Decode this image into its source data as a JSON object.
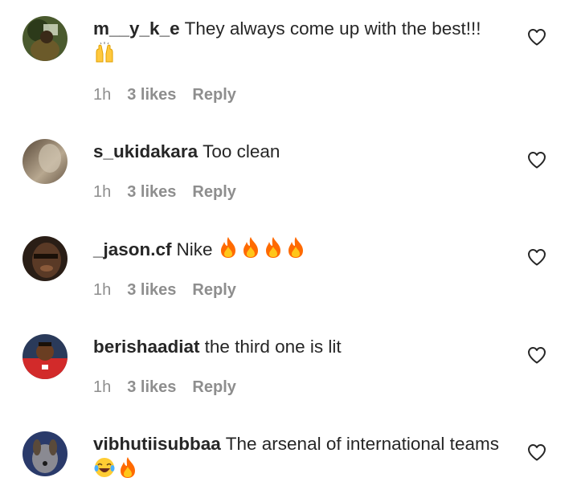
{
  "comments": [
    {
      "username": "m__y_k_e",
      "text": "They always come up with the best!!!",
      "emoji_after": [
        "raising-hands-emoji"
      ],
      "time": "1h",
      "likes": "3 likes",
      "reply": "Reply"
    },
    {
      "username": "s_ukidakara",
      "text": "Too clean",
      "time": "1h",
      "likes": "3 likes",
      "reply": "Reply"
    },
    {
      "username": "_jason.cf",
      "text": "Nike",
      "emoji_after": [
        "fire-emoji",
        "fire-emoji",
        "fire-emoji",
        "fire-emoji"
      ],
      "time": "1h",
      "likes": "3 likes",
      "reply": "Reply"
    },
    {
      "username": "berishaadiat",
      "text": "the third one is lit",
      "time": "1h",
      "likes": "3 likes",
      "reply": "Reply"
    },
    {
      "username": "vibhutiisubbaa",
      "text": "The arsenal of international teams",
      "emoji_after": [
        "laughing-emoji",
        "fire-emoji"
      ],
      "time": "",
      "likes": "",
      "reply": ""
    }
  ],
  "colors": {
    "text": "#262626",
    "secondary": "#8e8e8e",
    "fire": "#ff6a00"
  },
  "icons": {
    "like": "heart-outline-icon"
  }
}
